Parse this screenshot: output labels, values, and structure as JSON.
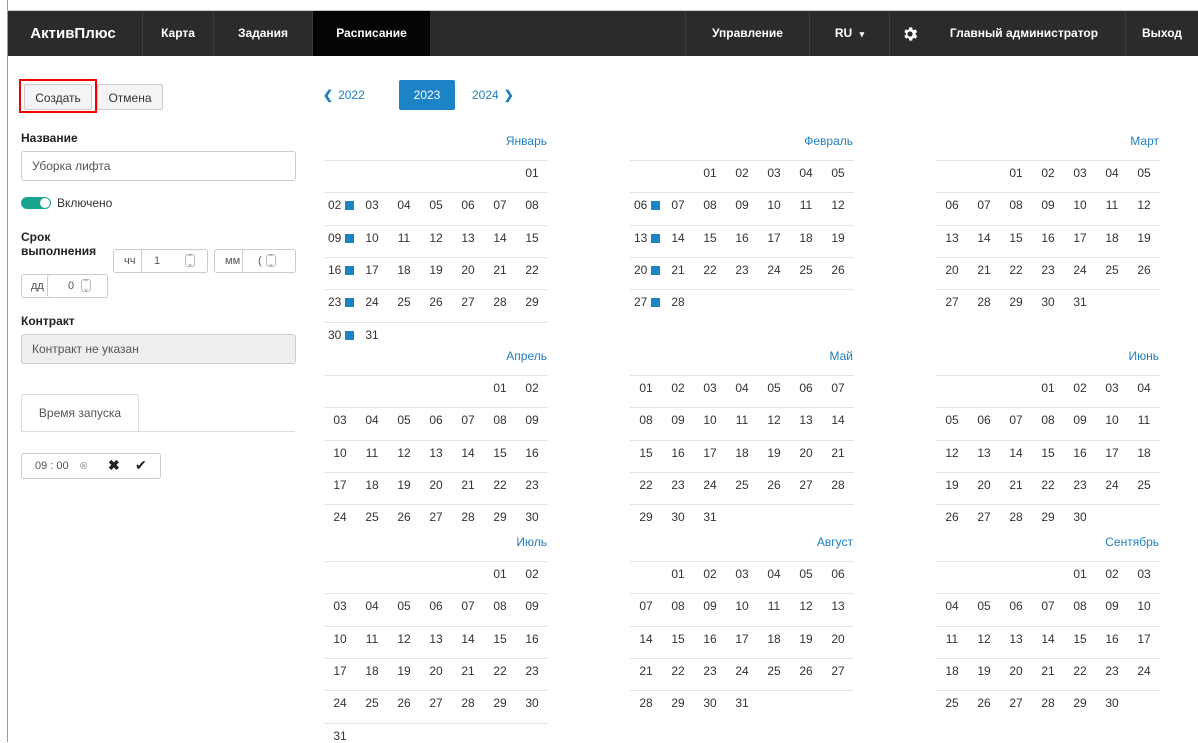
{
  "navbar": {
    "brand": "АктивПлюс",
    "items": [
      "Карта",
      "Задания",
      "Расписание"
    ],
    "active": "Расписание",
    "manage": "Управление",
    "lang": "RU",
    "user": "Главный администратор",
    "logout": "Выход"
  },
  "form": {
    "create_label": "Создать",
    "cancel_label": "Отмена",
    "name_label": "Название",
    "name_value": "Уборка лифта",
    "enabled_label": "Включено",
    "deadline_label_1": "Срок",
    "deadline_label_2": "выполнения",
    "hh_label": "чч",
    "hh_value": "1",
    "mm_label": "мм",
    "mm_value": "(",
    "dd_label": "дд",
    "dd_value": "0",
    "contract_label": "Контракт",
    "contract_value": "Контракт не указан",
    "tab_label": "Время запуска",
    "time_value": "09 : 00"
  },
  "years": {
    "prev": "2022",
    "current": "2023",
    "next": "2024"
  },
  "accent": "#1b83c6",
  "months": [
    {
      "name": "Январь",
      "start": 6,
      "days": 31,
      "marked": [
        "02",
        "09",
        "16",
        "23",
        "30"
      ]
    },
    {
      "name": "Февраль",
      "start": 2,
      "days": 28,
      "marked": [
        "06",
        "13",
        "20",
        "27"
      ]
    },
    {
      "name": "Март",
      "start": 2,
      "days": 31,
      "marked": []
    },
    {
      "name": "Апрель",
      "start": 5,
      "days": 30,
      "marked": []
    },
    {
      "name": "Май",
      "start": 0,
      "days": 31,
      "marked": []
    },
    {
      "name": "Июнь",
      "start": 3,
      "days": 30,
      "marked": []
    },
    {
      "name": "Июль",
      "start": 5,
      "days": 31,
      "marked": []
    },
    {
      "name": "Август",
      "start": 1,
      "days": 31,
      "marked": []
    },
    {
      "name": "Сентябрь",
      "start": 4,
      "days": 30,
      "marked": []
    }
  ]
}
